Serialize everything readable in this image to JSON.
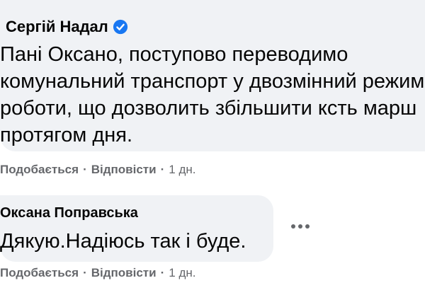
{
  "comments": [
    {
      "author": "Сергій Надал",
      "verified": true,
      "text_lines": [
        "Пані Оксано, поступово переводимо",
        "комунальний транспорт у двозмінний режим",
        "роботи, що дозволить збільшити ксть марш",
        "протягом дня."
      ],
      "actions": {
        "like": "Подобається",
        "separator": "·",
        "reply": "Відповісти",
        "time": "1 дн."
      }
    },
    {
      "author": "Оксана Поправська",
      "verified": false,
      "text": "Дякую.Надіюсь так і буде.",
      "actions": {
        "like": "Подобається",
        "separator": "·",
        "reply": "Відповісти",
        "time": "1 дн."
      }
    }
  ],
  "icons": {
    "verified": "verified-badge-icon",
    "more": "more-options-icon"
  },
  "colors": {
    "bubble": "#f0f2f5",
    "text": "#050505",
    "meta": "#65676b",
    "verified": "#1877f2"
  }
}
